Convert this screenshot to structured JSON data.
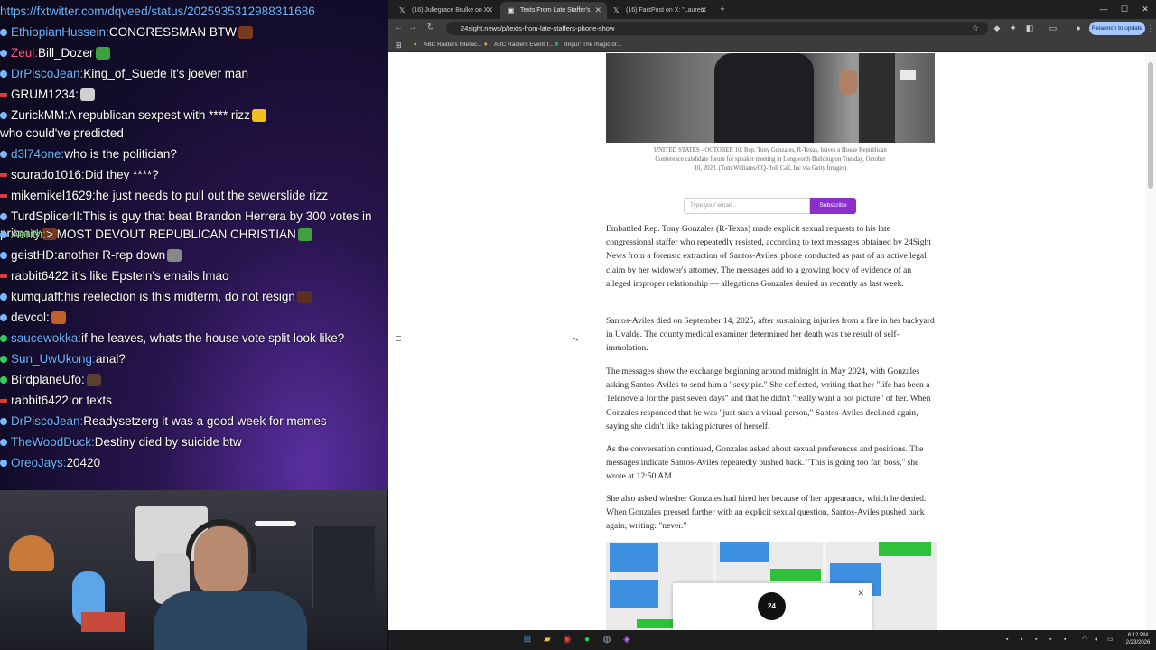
{
  "chat": {
    "lines": [
      {
        "badge": "none",
        "name": "",
        "name_color": "#6bb4ff",
        "text": "https://fxtwitter.com/dqveed/status/2025935312988311686",
        "emote": ""
      },
      {
        "badge": "blue",
        "name": "EthiopianHussein",
        "name_color": "#6bb4ff",
        "text": "CONGRESSMAN BTW",
        "emote": "#7b3a20"
      },
      {
        "badge": "blue",
        "name": "Zeul",
        "name_color": "#ff5a8a",
        "text": "Bill_Dozer",
        "emote": "#3fa03f"
      },
      {
        "badge": "blue",
        "name": "DrPiscoJean",
        "name_color": "#6bb4ff",
        "text": "King_of_Suede it's joever man",
        "emote": ""
      },
      {
        "badge": "red",
        "name": "GRUM1234",
        "name_color": "#ffffff",
        "text": "",
        "emote": "#cfcfcf"
      },
      {
        "badge": "blue",
        "name": "ZurickMM",
        "name_color": "#ffffff",
        "text": "A republican sexpest with **** rizz",
        "emote": "#f0c020"
      },
      {
        "badge": "none",
        "name": "",
        "name_color": "#ffffff",
        "text": "who could've predicted",
        "emote": ""
      },
      {
        "badge": "blue",
        "name": "d3l74one",
        "name_color": "#6bb4ff",
        "text": "who is the politician?",
        "emote": ""
      },
      {
        "badge": "red",
        "name": "scurado1016",
        "name_color": "#ffffff",
        "text": "Did they ****?",
        "emote": ""
      },
      {
        "badge": "red",
        "name": "mikemikel1629",
        "name_color": "#ffffff",
        "text": "he just needs to pull out the sewerslide rizz",
        "emote": ""
      },
      {
        "badge": "blue",
        "name": "TurdSplicerII",
        "name_color": "#ffffff",
        "text": "This is guy that beat Brandon Herrera by 300 votes in primary",
        "emote": "#7b3a20"
      },
      {
        "badge": "blue",
        "name": "Aerith",
        "name_color": "#70e070",
        "text": "> MOST DEVOUT REPUBLICAN CHRISTIAN",
        "emote": "#3fa03f"
      },
      {
        "badge": "blue",
        "name": "geistHD",
        "name_color": "#ffffff",
        "text": "another R-rep down",
        "emote": "#888888"
      },
      {
        "badge": "red",
        "name": "rabbit6422",
        "name_color": "#ffffff",
        "text": "it's like Epstein's emails lmao",
        "emote": ""
      },
      {
        "badge": "blue",
        "name": "kumquaff",
        "name_color": "#ffffff",
        "text": "his reelection is this midterm, do not resign",
        "emote": "#5a3020"
      },
      {
        "badge": "blue",
        "name": "devcol",
        "name_color": "#ffffff",
        "text": "",
        "emote": "#c0602a"
      },
      {
        "badge": "green",
        "name": "saucewokka",
        "name_color": "#6bb4ff",
        "text": "if he leaves, whats the house vote split look like?",
        "emote": ""
      },
      {
        "badge": "green",
        "name": "Sun_UwUkong",
        "name_color": "#6bb4ff",
        "text": "anal?",
        "emote": ""
      },
      {
        "badge": "green",
        "name": "BirdplaneUfo",
        "name_color": "#ffffff",
        "text": "",
        "emote": "#5a4030"
      },
      {
        "badge": "red",
        "name": "rabbit6422",
        "name_color": "#ffffff",
        "text": "or texts",
        "emote": ""
      },
      {
        "badge": "blue",
        "name": "DrPiscoJean",
        "name_color": "#6bb4ff",
        "text": "Readysetzerg it was a good week for memes",
        "emote": ""
      },
      {
        "badge": "blue",
        "name": "TheWoodDuck",
        "name_color": "#6bb4ff",
        "text": "Destiny died by suicide btw",
        "emote": ""
      },
      {
        "badge": "blue",
        "name": "OreoJays",
        "name_color": "#6bb4ff",
        "text": "20420",
        "emote": ""
      }
    ]
  },
  "browser": {
    "tabs": [
      {
        "label": "(16) Jullegrace Brulke on X: \"Ni",
        "icon": "x-logo-icon",
        "active": false
      },
      {
        "label": "Texts From Late Staffer's Phone",
        "icon": "24sight-favicon-icon",
        "active": true
      },
      {
        "label": "(16) FactPost on X: \"Lauren Bo",
        "icon": "x-logo-icon",
        "active": false
      }
    ],
    "new_tab": "+",
    "url": "24sight.news/p/texts-from-late-staffers-phone-show",
    "relaunch_label": "Relaunch to update",
    "bookmarks": [
      {
        "label": "ABC Raiders Interac...",
        "icon": "raiders-icon"
      },
      {
        "label": "ABC Raiders Event T...",
        "icon": "raiders-icon"
      },
      {
        "label": "Imgur: The magic of...",
        "icon": "imgur-icon"
      }
    ]
  },
  "article": {
    "caption": "UNITED STATES - OCTOBER 10: Rep. Tony Gonzales, R-Texas, leaves a House Republican Conference candidate forum for speaker meeting in Longworth Building on Tuesday, October 10, 2023. (Tom Williams/CQ-Roll Call, Inc via Getty Images)",
    "email_placeholder": "Type your email...",
    "subscribe_label": "Subscribe",
    "paragraphs": [
      "Embattled Rep. Tony Gonzales (R-Texas) made explicit sexual requests to his late congressional staffer who repeatedly resisted, according to text messages obtained by 24Sight News from a forensic extraction of Santos-Aviles' phone conducted as part of an active legal claim by her widower's attorney. The messages add to a growing body of evidence of an alleged improper relationship — allegations Gonzales denied as recently as last week.",
      "Santos-Aviles died on September 14, 2025, after sustaining injuries from a fire in her backyard in Uvalde. The county medical examiner determined her death was the result of self-immolation.",
      "The messages show the exchange beginning around midnight in May 2024, with Gonzales asking Santos-Aviles to send him a \"sexy pic.\" She deflected, writing that her \"life has been a Telenovela for the past seven days\" and that he didn't \"really want a hot picture\" of her. When Gonzales responded that he was \"just such a visual person,\" Santos-Aviles declined again, saying she didn't like taking pictures of herself.",
      "As the conversation continued, Gonzales asked about sexual preferences and positions. The messages indicate Santos-Aviles repeatedly pushed back. \"This is going too far, boss,\" she wrote at 12:50 AM.",
      "She also asked whether Gonzales had hired her because of her appearance, which he denied. When Gonzales pressed further with an explicit sexual question, Santos-Aviles pushed back again, writing: \"never.\""
    ],
    "ad_logo": "24 SIGHT",
    "ad_close": "✕"
  },
  "taskbar": {
    "time": "6:12 PM",
    "date": "2/23/2026"
  }
}
